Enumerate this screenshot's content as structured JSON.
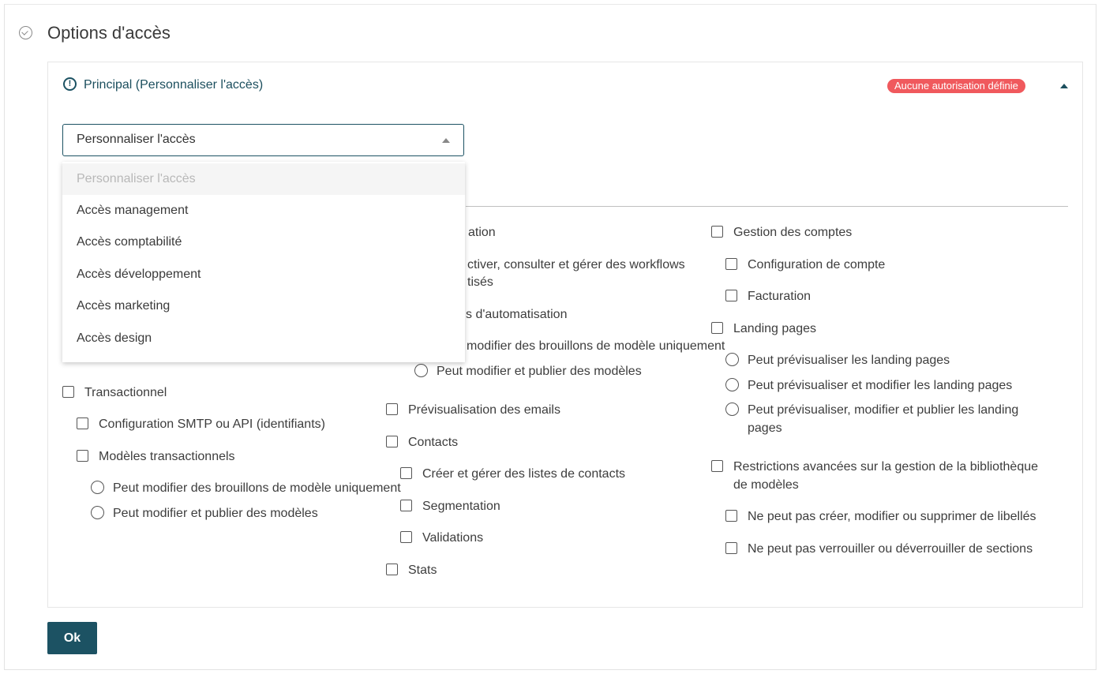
{
  "section": {
    "title": "Options d'accès",
    "icon": "check-circle-icon"
  },
  "panel": {
    "title": "Principal (Personnaliser l'accès)",
    "icon": "warning-circle-icon",
    "badge": "Aucune autorisation définie",
    "colors": {
      "accent": "#1c5263",
      "badge": "#f0595d"
    }
  },
  "select": {
    "value": "Personnaliser l'accès",
    "options": [
      "Personnaliser l'accès",
      "Accès management",
      "Accès comptabilité",
      "Accès développement",
      "Accès marketing",
      "Accès design"
    ]
  },
  "col1": {
    "transactionnel": "Transactionnel",
    "smtp": "Configuration SMTP ou API (identifiants)",
    "modeles_trans": "Modèles transactionnels",
    "trans_radio1": "Peut modifier des brouillons de modèle uniquement",
    "trans_radio2": "Peut modifier et publier des modèles"
  },
  "col2": {
    "automation_partial": "ation",
    "workflows_partial_1": "ctiver, consulter et gérer des workflows",
    "workflows_partial_2": "tisés",
    "auto_models_partial": "s d'automatisation",
    "auto_radio1_partial": "modifier des brouillons de modèle uniquement",
    "auto_radio2": "Peut modifier et publier des modèles",
    "preview_emails": "Prévisualisation des emails",
    "contacts": "Contacts",
    "lists": "Créer et gérer des listes de contacts",
    "segmentation": "Segmentation",
    "validations": "Validations",
    "stats": "Stats"
  },
  "col3": {
    "accounts": "Gestion des comptes",
    "account_config": "Configuration de compte",
    "billing": "Facturation",
    "landing": "Landing pages",
    "landing_r1": "Peut prévisualiser les landing pages",
    "landing_r2": "Peut prévisualiser et modifier les landing pages",
    "landing_r3": "Peut prévisualiser, modifier et publier les landing pages",
    "restrictions": "Restrictions avancées sur la gestion de la bibliothèque de modèles",
    "no_labels": "Ne peut pas créer, modifier ou supprimer de libellés",
    "no_lock": "Ne peut pas verrouiller ou déverrouiller de sections"
  },
  "actions": {
    "ok": "Ok"
  }
}
